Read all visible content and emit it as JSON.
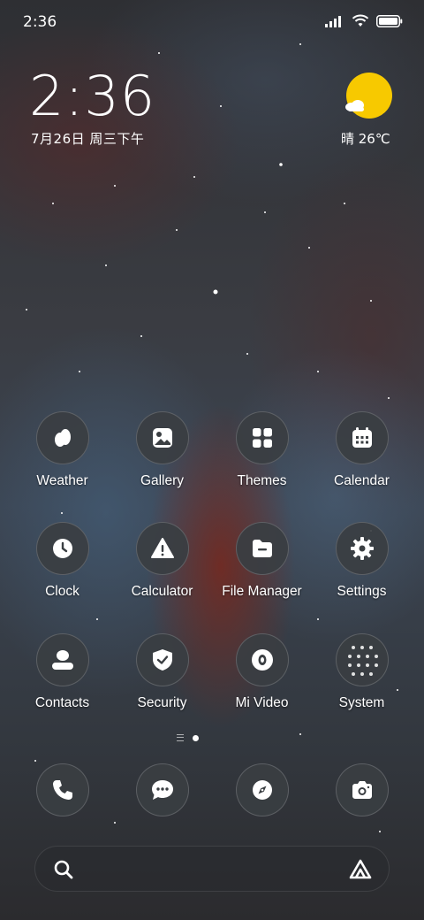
{
  "status_bar": {
    "time": "2:36"
  },
  "lockclock": {
    "time": "2:36",
    "date": "7月26日 周三下午"
  },
  "weather_widget": {
    "text": "晴 26℃",
    "sun_color": "#f7c900"
  },
  "apps": [
    {
      "label": "Weather",
      "icon": "weather-icon"
    },
    {
      "label": "Gallery",
      "icon": "gallery-icon"
    },
    {
      "label": "Themes",
      "icon": "themes-icon"
    },
    {
      "label": "Calendar",
      "icon": "calendar-icon"
    },
    {
      "label": "Clock",
      "icon": "clock-icon"
    },
    {
      "label": "Calculator",
      "icon": "calculator-icon"
    },
    {
      "label": "File Manager",
      "icon": "file-manager-icon"
    },
    {
      "label": "Settings",
      "icon": "settings-icon"
    },
    {
      "label": "Contacts",
      "icon": "contacts-icon"
    },
    {
      "label": "Security",
      "icon": "security-icon"
    },
    {
      "label": "Mi Video",
      "icon": "mi-video-icon"
    },
    {
      "label": "System",
      "icon": "system-folder-icon"
    }
  ],
  "dock": [
    {
      "icon": "phone-icon"
    },
    {
      "icon": "messages-icon"
    },
    {
      "icon": "browser-icon"
    },
    {
      "icon": "camera-icon"
    }
  ],
  "page_indicator": {
    "pages": 1,
    "current": 1
  }
}
